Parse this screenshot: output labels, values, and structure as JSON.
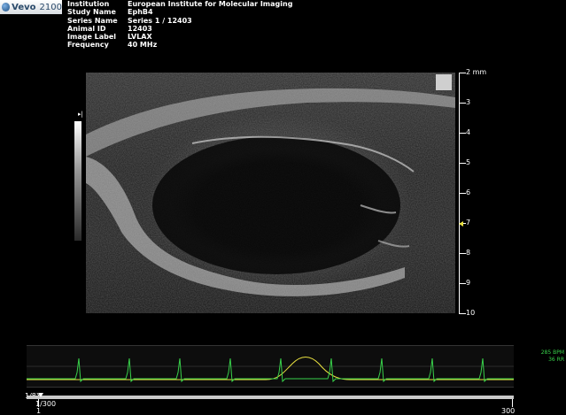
{
  "app": {
    "brand": "Vevo",
    "model": "2100"
  },
  "study": {
    "rows": [
      {
        "label": "Institution",
        "value": "European Institute for Molecular Imaging"
      },
      {
        "label": "Study Name",
        "value": "EphB4"
      },
      {
        "label": "Series Name",
        "value": "Series 1 / 12403"
      },
      {
        "label": "Animal ID",
        "value": "12403"
      },
      {
        "label": "Image Label",
        "value": "LVLAX"
      },
      {
        "label": "Frequency",
        "value": "40 MHz"
      }
    ]
  },
  "depth_scale": {
    "unit": "mm",
    "labels": [
      "2 mm",
      "3",
      "4",
      "5",
      "6",
      "7",
      "8",
      "9",
      "10"
    ]
  },
  "gray_bar": {
    "marker": "▸|"
  },
  "physio": {
    "heart_rate": "285 BPM",
    "resp_rate": "36 RR",
    "ecg_color": "#38d14a",
    "resp_color": "#e8e040"
  },
  "playback": {
    "speed": "1/8X",
    "frame": "1/300",
    "start": "1",
    "end": "300",
    "current_frame": 1,
    "total_frames": 300
  },
  "colors": {
    "background": "#000000",
    "focus_marker": "#e8e040",
    "text": "#ffffff"
  }
}
